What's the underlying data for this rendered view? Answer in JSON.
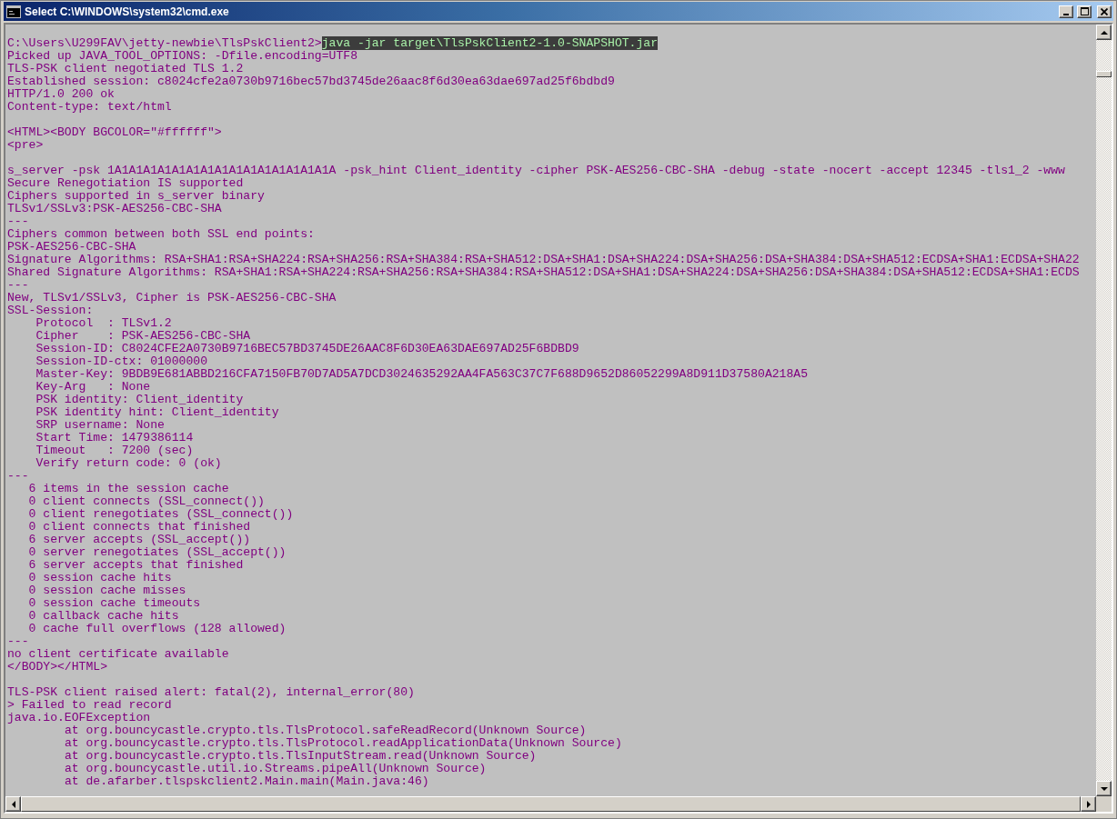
{
  "window": {
    "title": "Select C:\\WINDOWS\\system32\\cmd.exe"
  },
  "console": {
    "prompt": {
      "path": "C:\\Users\\U299FAV\\jetty-newbie\\TlsPskClient2>",
      "command": "java -jar target\\TlsPskClient2-1.0-SNAPSHOT.jar",
      "selected": true
    },
    "blocks": [
      [
        "Picked up JAVA_TOOL_OPTIONS: -Dfile.encoding=UTF8",
        "TLS-PSK client negotiated TLS 1.2",
        "Established session: c8024cfe2a0730b9716bec57bd3745de26aac8f6d30ea63dae697ad25f6bdbd9",
        "HTTP/1.0 200 ok",
        "Content-type: text/html"
      ],
      [
        "<HTML><BODY BGCOLOR=\"#ffffff\">",
        "<pre>"
      ],
      [
        "s_server -psk 1A1A1A1A1A1A1A1A1A1A1A1A1A1A1A1A -psk_hint Client_identity -cipher PSK-AES256-CBC-SHA -debug -state -nocert -accept 12345 -tls1_2 -www",
        "Secure Renegotiation IS supported",
        "Ciphers supported in s_server binary",
        "TLSv1/SSLv3:PSK-AES256-CBC-SHA",
        "---",
        "Ciphers common between both SSL end points:",
        "PSK-AES256-CBC-SHA",
        "Signature Algorithms: RSA+SHA1:RSA+SHA224:RSA+SHA256:RSA+SHA384:RSA+SHA512:DSA+SHA1:DSA+SHA224:DSA+SHA256:DSA+SHA384:DSA+SHA512:ECDSA+SHA1:ECDSA+SHA22",
        "Shared Signature Algorithms: RSA+SHA1:RSA+SHA224:RSA+SHA256:RSA+SHA384:RSA+SHA512:DSA+SHA1:DSA+SHA224:DSA+SHA256:DSA+SHA384:DSA+SHA512:ECDSA+SHA1:ECDS",
        "---",
        "New, TLSv1/SSLv3, Cipher is PSK-AES256-CBC-SHA",
        "SSL-Session:",
        "    Protocol  : TLSv1.2",
        "    Cipher    : PSK-AES256-CBC-SHA",
        "    Session-ID: C8024CFE2A0730B9716BEC57BD3745DE26AAC8F6D30EA63DAE697AD25F6BDBD9",
        "    Session-ID-ctx: 01000000",
        "    Master-Key: 9BDB9E681ABBD216CFA7150FB70D7AD5A7DCD3024635292AA4FA563C37C7F688D9652D86052299A8D911D37580A218A5",
        "    Key-Arg   : None",
        "    PSK identity: Client_identity",
        "    PSK identity hint: Client_identity",
        "    SRP username: None",
        "    Start Time: 1479386114",
        "    Timeout   : 7200 (sec)",
        "    Verify return code: 0 (ok)",
        "---",
        "   6 items in the session cache",
        "   0 client connects (SSL_connect())",
        "   0 client renegotiates (SSL_connect())",
        "   0 client connects that finished",
        "   6 server accepts (SSL_accept())",
        "   0 server renegotiates (SSL_accept())",
        "   6 server accepts that finished",
        "   0 session cache hits",
        "   0 session cache misses",
        "   0 session cache timeouts",
        "   0 callback cache hits",
        "   0 cache full overflows (128 allowed)",
        "---",
        "no client certificate available",
        "</BODY></HTML>"
      ],
      [
        "TLS-PSK client raised alert: fatal(2), internal_error(80)",
        "> Failed to read record",
        "java.io.EOFException",
        "\tat org.bouncycastle.crypto.tls.TlsProtocol.safeReadRecord(Unknown Source)",
        "\tat org.bouncycastle.crypto.tls.TlsProtocol.readApplicationData(Unknown Source)",
        "\tat org.bouncycastle.crypto.tls.TlsInputStream.read(Unknown Source)",
        "\tat org.bouncycastle.util.io.Streams.pipeAll(Unknown Source)",
        "\tat de.afarber.tlspskclient2.Main.main(Main.java:46)"
      ]
    ]
  }
}
